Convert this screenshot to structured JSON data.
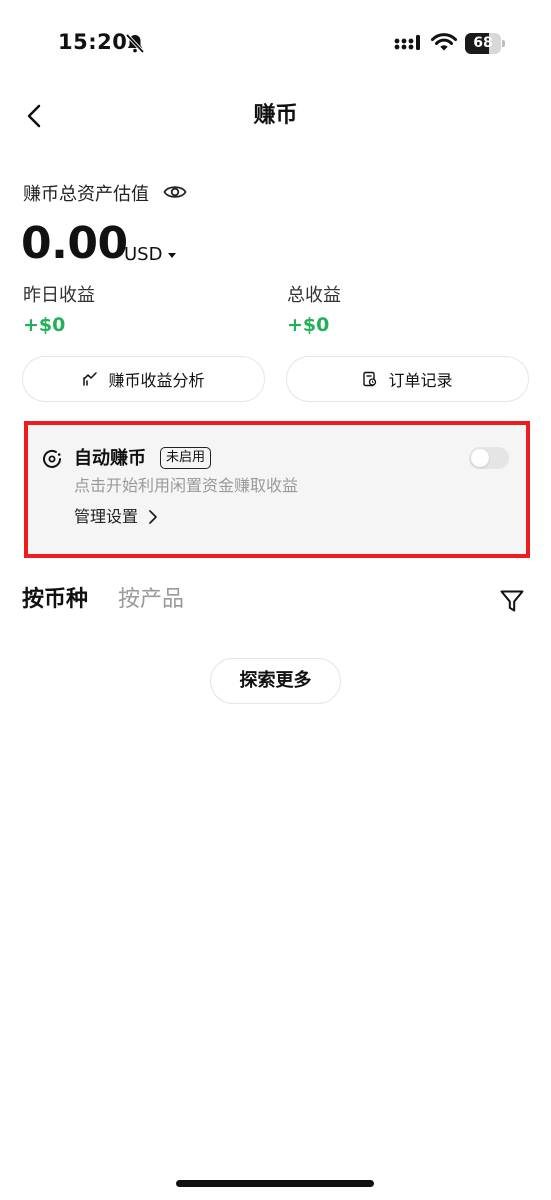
{
  "status_bar": {
    "time": "15:20",
    "battery_level": "68",
    "battery_fraction": 0.68,
    "icons": [
      "bell-muted-icon",
      "signal-icon",
      "wifi-icon",
      "battery-icon"
    ]
  },
  "header": {
    "title": "赚币",
    "back_icon": "chevron-left-icon"
  },
  "assets": {
    "label": "赚币总资产估值",
    "value": "0.00",
    "currency": "USD",
    "yesterday_label": "昨日收益",
    "yesterday_value": "+$0",
    "total_label": "总收益",
    "total_value": "+$0"
  },
  "actions": {
    "analysis_label": "赚币收益分析",
    "orders_label": "订单记录"
  },
  "auto_earn": {
    "title": "自动赚币",
    "badge": "未启用",
    "description": "点击开始利用闲置资金赚取收益",
    "manage_label": "管理设置",
    "enabled": false,
    "highlight_color": "#ee1c1c"
  },
  "tabs": [
    {
      "label": "按币种",
      "active": true
    },
    {
      "label": "按产品",
      "active": false
    }
  ],
  "explore_label": "探索更多",
  "colors": {
    "positive": "#22b05a",
    "muted_text": "#9a9a9a"
  }
}
